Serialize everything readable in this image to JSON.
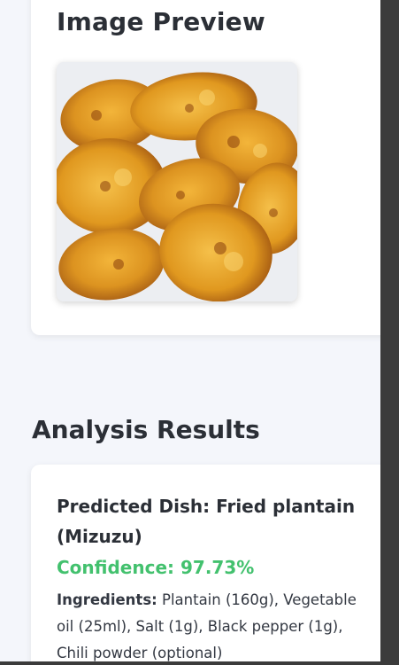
{
  "preview": {
    "title": "Image Preview",
    "image_alt": "fried plantain slices"
  },
  "results": {
    "title": "Analysis Results",
    "dish_label": "Predicted Dish: ",
    "dish_name": "Fried plantain (Mizuzu)",
    "confidence_label": "Confidence: ",
    "confidence_value": "97.73%",
    "ingredients_label": "Ingredients:",
    "ingredients_text": " Plantain (160g), Vegetable oil (25ml), Salt (1g), Black pepper (1g), Chili powder (optional)"
  },
  "colors": {
    "background": "#f4f6fb",
    "card": "#ffffff",
    "heading": "#2b2f36",
    "confidence": "#43c16e",
    "plantain": "#d9901e"
  }
}
